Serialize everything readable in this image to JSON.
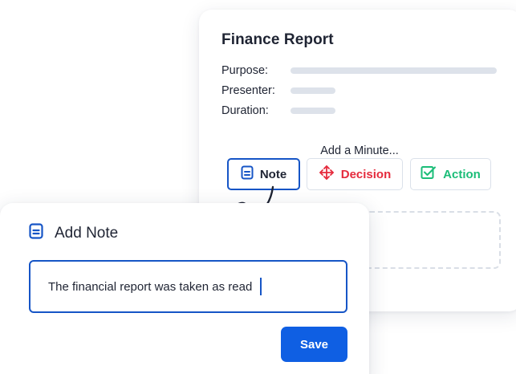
{
  "report": {
    "title": "Finance Report",
    "fields": [
      {
        "label": "Purpose:"
      },
      {
        "label": "Presenter:"
      },
      {
        "label": "Duration:"
      }
    ],
    "add_minute_label": "Add a Minute...",
    "buttons": {
      "note": "Note",
      "decision": "Decision",
      "action": "Action"
    }
  },
  "note": {
    "title": "Add Note",
    "input_value": "The financial report was taken as read",
    "save_label": "Save"
  },
  "colors": {
    "primary": "#0f5fe3",
    "focus_border": "#1655c6",
    "decision": "#e52a3c",
    "action": "#1bbd78",
    "placeholder_bar": "#dde2ea",
    "text": "#1f2433"
  },
  "icons": {
    "note": "note-document-icon",
    "decision": "move-arrows-icon",
    "action": "checkbox-check-icon",
    "add_note": "note-document-icon",
    "arrow": "curly-arrow-icon"
  }
}
